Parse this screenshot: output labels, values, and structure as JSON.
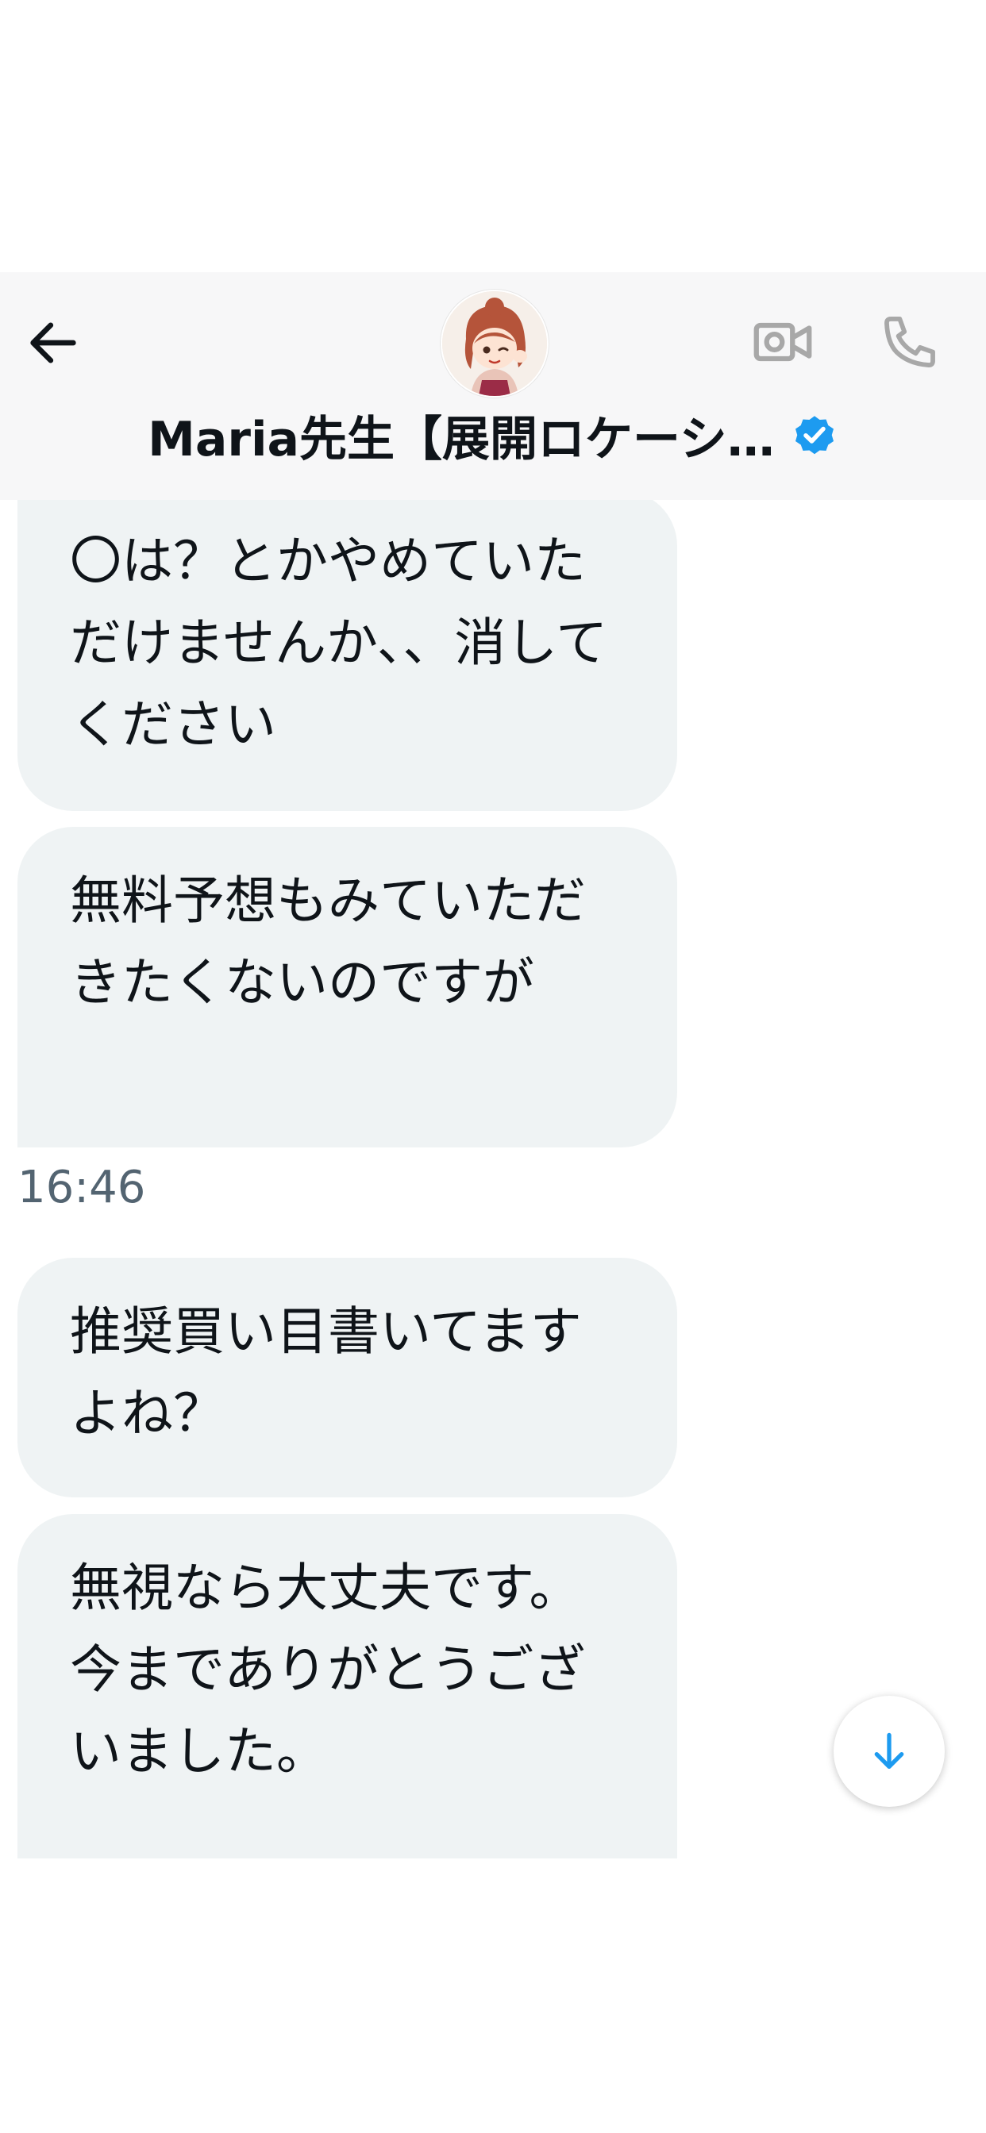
{
  "header": {
    "title": "Maria先生【展開ロケーシ…",
    "back_icon": "arrow-left-icon",
    "video_icon": "video-camera-icon",
    "phone_icon": "phone-icon",
    "verified_icon": "verified-badge-icon",
    "accent_color": "#1d9bf0"
  },
  "messages": [
    {
      "text": "〇は？とかやめていただけませんか、、消してください"
    },
    {
      "text": "無料予想もみていただきたくないのですが"
    },
    {
      "text": "推奨買い目書いてますよね？"
    },
    {
      "text": "無視なら大丈夫です。\n今までありがとうございました。"
    }
  ],
  "timestamp": "16:46",
  "scroll_button": {
    "icon": "arrow-down-icon"
  }
}
